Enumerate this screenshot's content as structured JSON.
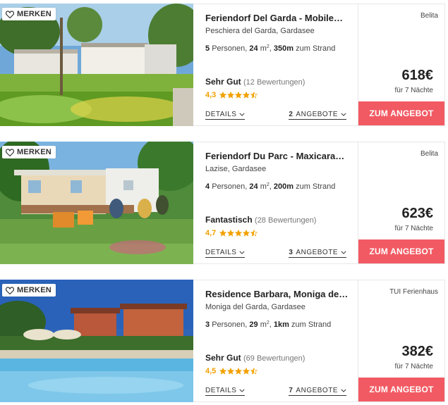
{
  "common": {
    "merken_label": "MERKEN",
    "details_label": "DETAILS",
    "offers_suffix": "ANGEBOTE",
    "cta_label": "ZUM ANGEBOT",
    "per_nights": "für 7 Nächte",
    "to_beach": "zum Strand",
    "persons_word": "Personen,",
    "area_unit": "m",
    "area_sup": "2",
    "star_color": "#f2a100",
    "cta_color": "#f25a63",
    "icons": [
      "heart-icon",
      "star-icon",
      "chevron-down-icon"
    ]
  },
  "listings": [
    {
      "title": "Feriendorf Del Garda - Mobile…",
      "location": "Peschiera del Garda, Gardasee",
      "persons": "5",
      "area": "24",
      "distance": "350m",
      "rating_label": "Sehr Gut",
      "reviews": "(12 Bewertungen)",
      "score": "4,3",
      "stars": 4.3,
      "offers_count": "2",
      "provider": "Belita",
      "price": "618€"
    },
    {
      "title": "Feriendorf Du Parc - Maxicara…",
      "location": "Lazise, Gardasee",
      "persons": "4",
      "area": "24",
      "distance": "200m",
      "rating_label": "Fantastisch",
      "reviews": "(28 Bewertungen)",
      "score": "4,7",
      "stars": 4.7,
      "offers_count": "3",
      "provider": "Belita",
      "price": "623€"
    },
    {
      "title": "Residence Barbara, Moniga de…",
      "location": "Moniga del Garda, Gardasee",
      "persons": "3",
      "area": "29",
      "distance": "1km",
      "rating_label": "Sehr Gut",
      "reviews": "(69 Bewertungen)",
      "score": "4,5",
      "stars": 4.5,
      "offers_count": "7",
      "provider": "TUI Ferienhaus",
      "price": "382€"
    }
  ]
}
